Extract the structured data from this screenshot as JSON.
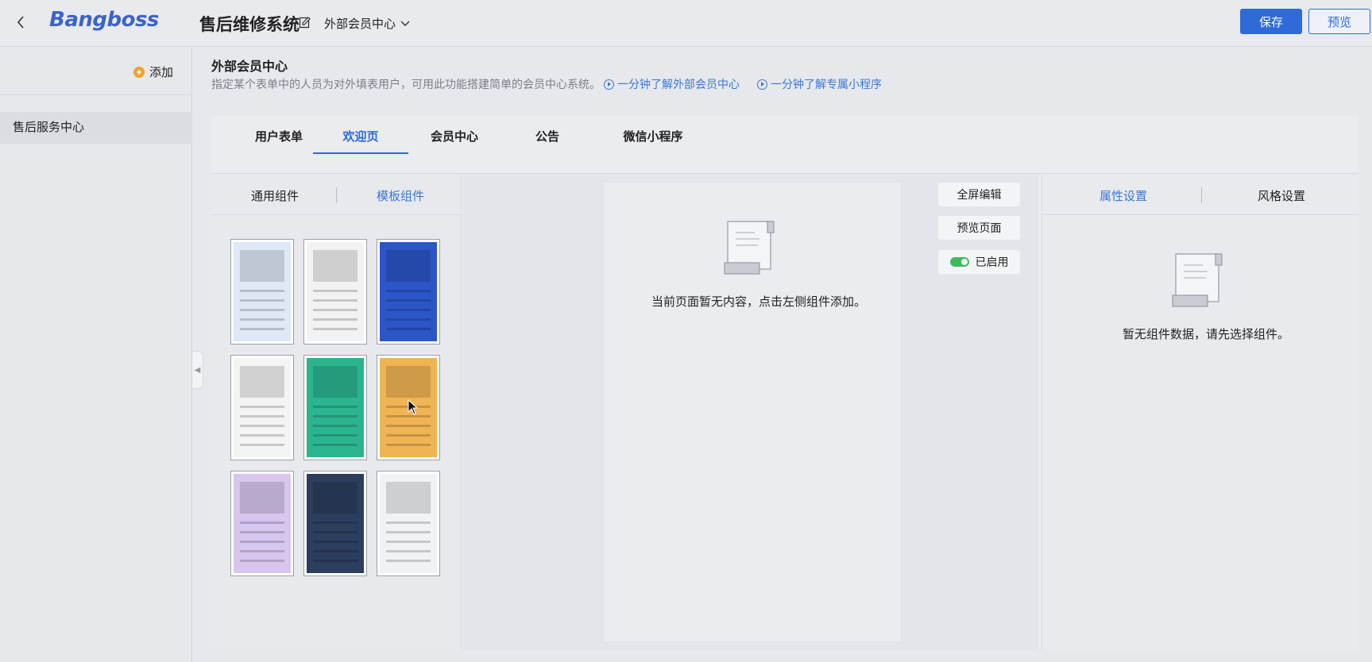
{
  "topbar": {
    "logo": "Bangboss",
    "app_title": "售后维修系统",
    "module_select": "外部会员中心",
    "save_label": "保存",
    "preview_label": "预览"
  },
  "sidebar": {
    "add_label": "添加",
    "items": [
      {
        "label": "售后服务中心"
      }
    ]
  },
  "header": {
    "title": "外部会员中心",
    "description": "指定某个表单中的人员为对外填表用户，可用此功能搭建简单的会员中心系统。",
    "link1": "一分钟了解外部会员中心",
    "link2": "一分钟了解专属小程序"
  },
  "tabs": [
    {
      "label": "用户表单"
    },
    {
      "label": "欢迎页"
    },
    {
      "label": "会员中心"
    },
    {
      "label": "公告"
    },
    {
      "label": "微信小程序"
    }
  ],
  "components": {
    "tab_general": "通用组件",
    "tab_template": "模板组件",
    "templates": [
      {
        "name": "template-1",
        "color": "#dfe8f7"
      },
      {
        "name": "template-2",
        "color": "#f2f2f2"
      },
      {
        "name": "template-3",
        "color": "#2c55c8"
      },
      {
        "name": "template-4",
        "color": "#f4f4f4"
      },
      {
        "name": "template-5",
        "color": "#2bb58f"
      },
      {
        "name": "template-6",
        "color": "#f0b454"
      },
      {
        "name": "template-7",
        "color": "#d7c6ee"
      },
      {
        "name": "template-8",
        "color": "#2c3e5e"
      },
      {
        "name": "template-9",
        "color": "#f0f2f6"
      }
    ]
  },
  "canvas": {
    "empty_text": "当前页面暂无内容，点击左侧组件添加。",
    "fullscreen_edit": "全屏编辑",
    "preview_page": "预览页面",
    "enabled_label": "已启用"
  },
  "properties": {
    "tab_props": "属性设置",
    "tab_style": "风格设置",
    "empty_text": "暂无组件数据，请先选择组件。"
  }
}
